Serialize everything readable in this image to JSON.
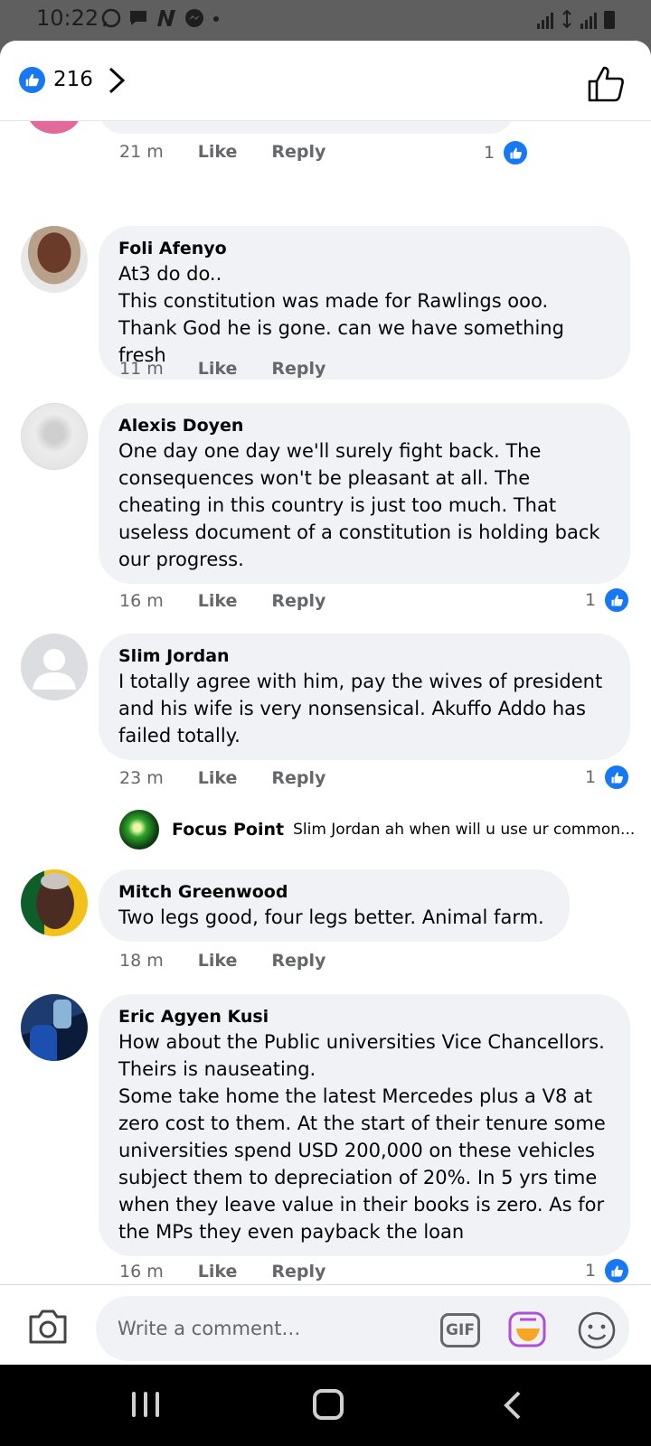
{
  "status_bar": {
    "time": "10:22"
  },
  "header": {
    "reaction_count": "216"
  },
  "colors": {
    "accent": "#1877f2",
    "bubble": "#f0f2f5",
    "meta_text": "#65676b"
  },
  "comments": [
    {
      "time": "21 m",
      "like": "Like",
      "reply": "Reply",
      "reactions": "1"
    },
    {
      "author": "Foli Afenyo",
      "text": "At3 do do..\nThis constitution was made for Rawlings ooo. Thank God he is gone. can we have something fresh",
      "time": "11 m",
      "like": "Like",
      "reply": "Reply"
    },
    {
      "author": "Alexis Doyen",
      "text": "One day  one day we'll surely fight back. The consequences won't be pleasant at all. The cheating in this country is just too much. That useless document of a constitution is holding back our progress.",
      "time": "16 m",
      "like": "Like",
      "reply": "Reply",
      "reactions": "1"
    },
    {
      "author": "Slim Jordan",
      "text": "I totally agree with him, pay the wives of president and his wife is very nonsensical. Akuffo Addo has failed totally.",
      "time": "23 m",
      "like": "Like",
      "reply": "Reply",
      "reactions": "1",
      "reply_preview": {
        "author": "Focus Point",
        "text": "Slim Jordan ah when will u use ur common..."
      }
    },
    {
      "author": "Mitch Greenwood",
      "text": "Two legs good, four legs better. Animal farm.",
      "time": "18 m",
      "like": "Like",
      "reply": "Reply"
    },
    {
      "author": "Eric Agyen Kusi",
      "text": "How about the Public universities Vice Chancellors. Theirs is nauseating.\nSome take home the latest Mercedes plus a V8 at zero cost to them. At the start of their tenure some universities spend USD 200,000 on these vehicles subject them to depreciation of 20%. In 5 yrs time when they leave value in their books is zero. As for the MPs they even payback the loan",
      "time": "16 m",
      "like": "Like",
      "reply": "Reply",
      "reactions": "1"
    }
  ],
  "composer": {
    "placeholder": "Write a comment…",
    "gif_label": "GIF"
  }
}
